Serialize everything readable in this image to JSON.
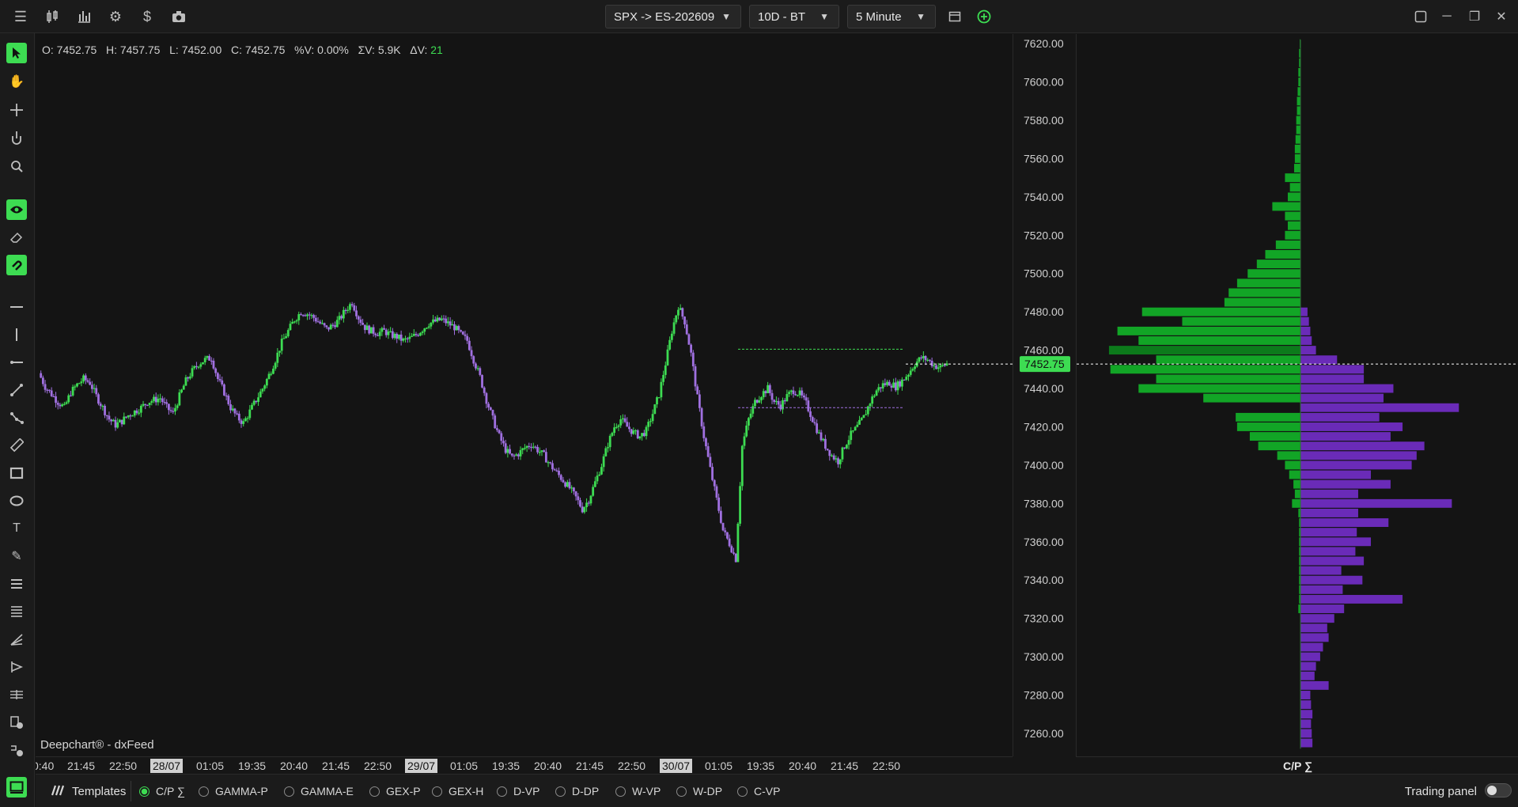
{
  "toolbar": {
    "symbol": "SPX -> ES-202609",
    "range": "10D - BT",
    "interval": "5 Minute"
  },
  "ohlc": {
    "open": "O: 7452.75",
    "high": "H: 7457.75",
    "low": "L: 7452.00",
    "close": "C: 7452.75",
    "pct_volume": "%V: 0.00%",
    "sum_volume": "ΣV: 5.9K",
    "delta_label": "ΔV:",
    "delta_value": "21"
  },
  "credit": "Deepchart® - dxFeed",
  "current_price": "7452.75",
  "price_axis_labels": [
    "7620.00",
    "7600.00",
    "7580.00",
    "7560.00",
    "7540.00",
    "7520.00",
    "7500.00",
    "7480.00",
    "7460.00",
    "7440.00",
    "7420.00",
    "7400.00",
    "7380.00",
    "7360.00",
    "7340.00",
    "7320.00",
    "7300.00",
    "7280.00",
    "7260.00"
  ],
  "time_axis_labels": [
    {
      "text": "0:40",
      "hl": false
    },
    {
      "text": "21:45",
      "hl": false
    },
    {
      "text": "22:50",
      "hl": false
    },
    {
      "text": "28/07",
      "hl": true
    },
    {
      "text": "01:05",
      "hl": false
    },
    {
      "text": "19:35",
      "hl": false
    },
    {
      "text": "20:40",
      "hl": false
    },
    {
      "text": "21:45",
      "hl": false
    },
    {
      "text": "22:50",
      "hl": false
    },
    {
      "text": "29/07",
      "hl": true
    },
    {
      "text": "01:05",
      "hl": false
    },
    {
      "text": "19:35",
      "hl": false
    },
    {
      "text": "20:40",
      "hl": false
    },
    {
      "text": "21:45",
      "hl": false
    },
    {
      "text": "22:50",
      "hl": false
    },
    {
      "text": "30/07",
      "hl": true
    },
    {
      "text": "01:05",
      "hl": false
    },
    {
      "text": "19:35",
      "hl": false
    },
    {
      "text": "20:40",
      "hl": false
    },
    {
      "text": "21:45",
      "hl": false
    },
    {
      "text": "22:50",
      "hl": false
    }
  ],
  "profile_label": "C/P ∑",
  "bottom": {
    "templates_label": "Templates",
    "options": [
      "C/P ∑",
      "GAMMA-P",
      "GAMMA-E",
      "GEX-P",
      "GEX-H",
      "D-VP",
      "D-DP",
      "W-VP",
      "W-DP",
      "C-VP"
    ],
    "selected": 0,
    "trading_panel_label": "Trading panel"
  },
  "colors": {
    "up": "#3ddc52",
    "down": "#a070e0",
    "call_bar": "#12a526",
    "put_bar": "#6a2bb8",
    "accent": "#3ddc52"
  },
  "levels": {
    "upper": 7460.5,
    "lower": 7430.0
  },
  "chart_data": {
    "type": "candlestick",
    "ylim": [
      7248,
      7625
    ],
    "price_path": [
      7448,
      7441,
      7437,
      7433,
      7430,
      7438,
      7442,
      7445,
      7443,
      7436,
      7430,
      7424,
      7421,
      7423,
      7426,
      7428,
      7430,
      7433,
      7434,
      7435,
      7430,
      7427,
      7436,
      7444,
      7449,
      7453,
      7455,
      7456,
      7445,
      7438,
      7430,
      7425,
      7422,
      7428,
      7434,
      7440,
      7447,
      7455,
      7464,
      7470,
      7476,
      7480,
      7479,
      7477,
      7474,
      7471,
      7473,
      7476,
      7481,
      7485,
      7477,
      7472,
      7470,
      7469,
      7470,
      7468,
      7467,
      7465,
      7466,
      7468,
      7471,
      7474,
      7475,
      7476,
      7474,
      7472,
      7468,
      7465,
      7455,
      7446,
      7434,
      7424,
      7415,
      7408,
      7404,
      7406,
      7409,
      7411,
      7408,
      7405,
      7400,
      7396,
      7392,
      7388,
      7383,
      7377,
      7382,
      7391,
      7400,
      7411,
      7420,
      7424,
      7420,
      7417,
      7415,
      7418,
      7427,
      7437,
      7453,
      7470,
      7483,
      7475,
      7458,
      7435,
      7415,
      7398,
      7382,
      7366,
      7359,
      7351,
      7410,
      7424,
      7433,
      7437,
      7440,
      7433,
      7431,
      7436,
      7439,
      7437,
      7432,
      7424,
      7416,
      7410,
      7405,
      7402,
      7410,
      7416,
      7420,
      7425,
      7433,
      7439,
      7442,
      7443,
      7441,
      7444,
      7448,
      7453,
      7456,
      7455,
      7452,
      7451,
      7453
    ],
    "profile": {
      "price_labels": [
        "7620.00",
        "7600.00",
        "7580.00",
        "7560.00",
        "7540.00",
        "7520.00",
        "7500.00",
        "7480.00",
        "7460.00",
        "7440.00",
        "7420.00",
        "7400.00",
        "7380.00",
        "7360.00",
        "7340.00",
        "7320.00",
        "7300.00",
        "7280.00",
        "7260.00"
      ],
      "call_values": [
        {
          "price": 7620,
          "value": 1
        },
        {
          "price": 7615,
          "value": 2
        },
        {
          "price": 7610,
          "value": 2
        },
        {
          "price": 7605,
          "value": 3
        },
        {
          "price": 7600,
          "value": 3
        },
        {
          "price": 7595,
          "value": 4
        },
        {
          "price": 7590,
          "value": 5
        },
        {
          "price": 7585,
          "value": 5
        },
        {
          "price": 7580,
          "value": 6
        },
        {
          "price": 7575,
          "value": 6
        },
        {
          "price": 7570,
          "value": 7
        },
        {
          "price": 7565,
          "value": 8
        },
        {
          "price": 7560,
          "value": 8
        },
        {
          "price": 7555,
          "value": 9
        },
        {
          "price": 7550,
          "value": 22
        },
        {
          "price": 7545,
          "value": 15
        },
        {
          "price": 7540,
          "value": 18
        },
        {
          "price": 7535,
          "value": 40
        },
        {
          "price": 7530,
          "value": 22
        },
        {
          "price": 7525,
          "value": 18
        },
        {
          "price": 7520,
          "value": 22
        },
        {
          "price": 7515,
          "value": 35
        },
        {
          "price": 7510,
          "value": 50
        },
        {
          "price": 7505,
          "value": 62
        },
        {
          "price": 7500,
          "value": 75
        },
        {
          "price": 7495,
          "value": 90
        },
        {
          "price": 7490,
          "value": 102
        },
        {
          "price": 7485,
          "value": 108
        },
        {
          "price": 7480,
          "value": 225
        },
        {
          "price": 7475,
          "value": 168
        },
        {
          "price": 7470,
          "value": 260
        },
        {
          "price": 7465,
          "value": 230
        },
        {
          "price": 7460,
          "value": 272
        },
        {
          "price": 7455,
          "value": 205
        },
        {
          "price": 7450,
          "value": 270
        },
        {
          "price": 7445,
          "value": 205
        },
        {
          "price": 7440,
          "value": 230
        },
        {
          "price": 7435,
          "value": 138
        },
        {
          "price": 7430,
          "value": 0
        },
        {
          "price": 7425,
          "value": 92
        },
        {
          "price": 7420,
          "value": 90
        },
        {
          "price": 7415,
          "value": 72
        },
        {
          "price": 7410,
          "value": 60
        },
        {
          "price": 7405,
          "value": 33
        },
        {
          "price": 7400,
          "value": 22
        },
        {
          "price": 7395,
          "value": 16
        },
        {
          "price": 7390,
          "value": 10
        },
        {
          "price": 7385,
          "value": 8
        },
        {
          "price": 7380,
          "value": 12
        },
        {
          "price": 7375,
          "value": 3
        },
        {
          "price": 7370,
          "value": 2
        },
        {
          "price": 7365,
          "value": 2
        },
        {
          "price": 7360,
          "value": 2
        },
        {
          "price": 7355,
          "value": 2
        },
        {
          "price": 7350,
          "value": 2
        },
        {
          "price": 7345,
          "value": 2
        },
        {
          "price": 7340,
          "value": 2
        },
        {
          "price": 7335,
          "value": 2
        },
        {
          "price": 7330,
          "value": 2
        },
        {
          "price": 7325,
          "value": 3
        }
      ],
      "put_values": [
        {
          "price": 7480,
          "value": 10
        },
        {
          "price": 7475,
          "value": 12
        },
        {
          "price": 7470,
          "value": 14
        },
        {
          "price": 7465,
          "value": 16
        },
        {
          "price": 7460,
          "value": 22
        },
        {
          "price": 7455,
          "value": 52
        },
        {
          "price": 7450,
          "value": 90
        },
        {
          "price": 7445,
          "value": 90
        },
        {
          "price": 7440,
          "value": 132
        },
        {
          "price": 7435,
          "value": 118
        },
        {
          "price": 7430,
          "value": 225
        },
        {
          "price": 7425,
          "value": 112
        },
        {
          "price": 7420,
          "value": 145
        },
        {
          "price": 7415,
          "value": 128
        },
        {
          "price": 7410,
          "value": 176
        },
        {
          "price": 7405,
          "value": 165
        },
        {
          "price": 7400,
          "value": 158
        },
        {
          "price": 7395,
          "value": 100
        },
        {
          "price": 7390,
          "value": 128
        },
        {
          "price": 7385,
          "value": 82
        },
        {
          "price": 7380,
          "value": 215
        },
        {
          "price": 7375,
          "value": 82
        },
        {
          "price": 7370,
          "value": 125
        },
        {
          "price": 7365,
          "value": 80
        },
        {
          "price": 7360,
          "value": 100
        },
        {
          "price": 7355,
          "value": 78
        },
        {
          "price": 7350,
          "value": 90
        },
        {
          "price": 7345,
          "value": 58
        },
        {
          "price": 7340,
          "value": 88
        },
        {
          "price": 7335,
          "value": 60
        },
        {
          "price": 7330,
          "value": 145
        },
        {
          "price": 7325,
          "value": 62
        },
        {
          "price": 7320,
          "value": 48
        },
        {
          "price": 7315,
          "value": 38
        },
        {
          "price": 7310,
          "value": 40
        },
        {
          "price": 7305,
          "value": 32
        },
        {
          "price": 7300,
          "value": 28
        },
        {
          "price": 7295,
          "value": 22
        },
        {
          "price": 7290,
          "value": 20
        },
        {
          "price": 7285,
          "value": 40
        },
        {
          "price": 7280,
          "value": 14
        },
        {
          "price": 7275,
          "value": 15
        },
        {
          "price": 7270,
          "value": 17
        },
        {
          "price": 7265,
          "value": 15
        },
        {
          "price": 7260,
          "value": 16
        },
        {
          "price": 7255,
          "value": 17
        }
      ]
    }
  }
}
